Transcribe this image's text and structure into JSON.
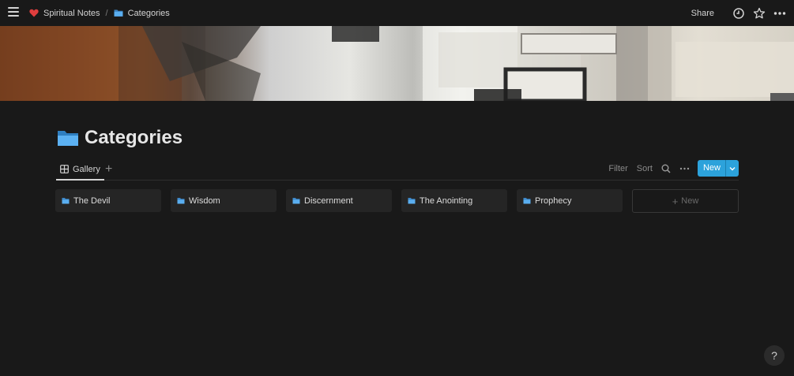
{
  "topbar": {
    "breadcrumbs": [
      {
        "label": "Spiritual Notes",
        "icon": "heart-icon"
      },
      {
        "label": "Categories",
        "icon": "folder-icon"
      }
    ],
    "separator": "/",
    "share_label": "Share"
  },
  "page": {
    "title": "Categories",
    "title_icon": "folder-icon"
  },
  "views": {
    "tabs": [
      {
        "label": "Gallery",
        "icon": "gallery-icon"
      }
    ],
    "add_view": "+",
    "filter_label": "Filter",
    "sort_label": "Sort",
    "new_label": "New"
  },
  "gallery": {
    "cards": [
      {
        "label": "The Devil"
      },
      {
        "label": "Wisdom"
      },
      {
        "label": "Discernment"
      },
      {
        "label": "The Anointing"
      },
      {
        "label": "Prophecy"
      }
    ],
    "new_card_label": "New",
    "new_card_plus": "+"
  },
  "help": {
    "label": "?"
  },
  "colors": {
    "background": "#191919",
    "accent": "#2ca2db",
    "heart": "#e03e3e",
    "folder": "#4a9fe0"
  }
}
